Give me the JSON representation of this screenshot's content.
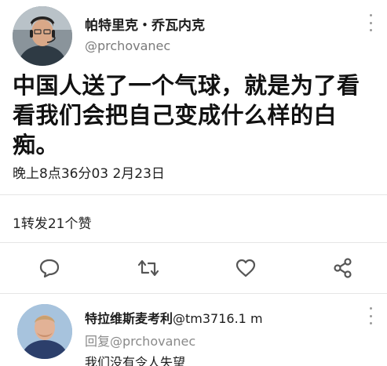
{
  "tweet": {
    "display_name": "帕特里克・乔瓦内克",
    "handle": "@prchovanec",
    "text": "中国人送了一个气球，就是为了看看我们会把自己变成什么样的白痴。",
    "timestamp": "晚上8点36分03 2月23日",
    "counts": "1转发21个赞"
  },
  "actions": [
    {
      "name": "reply",
      "icon": "speech-bubble-icon"
    },
    {
      "name": "retweet",
      "icon": "retweet-icon"
    },
    {
      "name": "like",
      "icon": "heart-icon"
    },
    {
      "name": "share",
      "icon": "share-icon"
    }
  ],
  "reply": {
    "display_name": "特拉维斯麦考利",
    "handle_suffix": "@tm3716.1 m",
    "replying_to": "回复@prchovanec",
    "text": "我们没有令人失望"
  },
  "colors": {
    "text": "#111111",
    "secondary_text": "#7a7a7a",
    "icon": "#555555",
    "divider": "#e6e6e6",
    "background": "#ffffff"
  }
}
